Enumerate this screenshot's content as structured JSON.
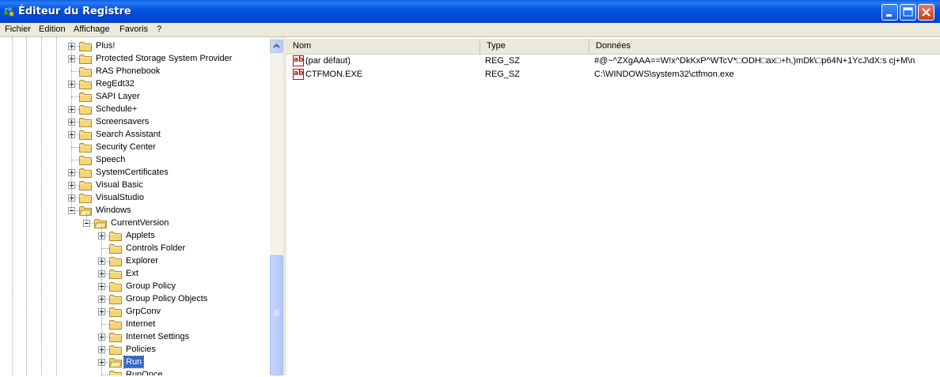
{
  "window": {
    "title": "Éditeur du Registre",
    "icon": "regedit-icon"
  },
  "menu": [
    "Fichier",
    "Edition",
    "Affichage",
    "Favoris",
    "?"
  ],
  "tree": {
    "items": [
      {
        "label": "Plus!",
        "level": 0,
        "expander": "plus"
      },
      {
        "label": "Protected Storage System Provider",
        "level": 0,
        "expander": "plus"
      },
      {
        "label": "RAS Phonebook",
        "level": 0,
        "expander": "none"
      },
      {
        "label": "RegEdt32",
        "level": 0,
        "expander": "plus"
      },
      {
        "label": "SAPI Layer",
        "level": 0,
        "expander": "none"
      },
      {
        "label": "Schedule+",
        "level": 0,
        "expander": "plus"
      },
      {
        "label": "Screensavers",
        "level": 0,
        "expander": "plus"
      },
      {
        "label": "Search Assistant",
        "level": 0,
        "expander": "plus"
      },
      {
        "label": "Security Center",
        "level": 0,
        "expander": "none"
      },
      {
        "label": "Speech",
        "level": 0,
        "expander": "none"
      },
      {
        "label": "SystemCertificates",
        "level": 0,
        "expander": "plus"
      },
      {
        "label": "Visual Basic",
        "level": 0,
        "expander": "plus"
      },
      {
        "label": "VisualStudio",
        "level": 0,
        "expander": "plus"
      },
      {
        "label": "Windows",
        "level": 0,
        "expander": "minus"
      },
      {
        "label": "CurrentVersion",
        "level": 1,
        "expander": "minus"
      },
      {
        "label": "Applets",
        "level": 2,
        "expander": "plus"
      },
      {
        "label": "Controls Folder",
        "level": 2,
        "expander": "none"
      },
      {
        "label": "Explorer",
        "level": 2,
        "expander": "plus"
      },
      {
        "label": "Ext",
        "level": 2,
        "expander": "plus"
      },
      {
        "label": "Group Policy",
        "level": 2,
        "expander": "plus"
      },
      {
        "label": "Group Policy Objects",
        "level": 2,
        "expander": "plus"
      },
      {
        "label": "GrpConv",
        "level": 2,
        "expander": "plus"
      },
      {
        "label": "Internet",
        "level": 2,
        "expander": "none"
      },
      {
        "label": "Internet Settings",
        "level": 2,
        "expander": "plus"
      },
      {
        "label": "Policies",
        "level": 2,
        "expander": "plus"
      },
      {
        "label": "Run",
        "level": 2,
        "expander": "plus",
        "selected": true
      },
      {
        "label": "RunOnce",
        "level": 2,
        "expander": "none"
      }
    ]
  },
  "list": {
    "columns": [
      "Nom",
      "Type",
      "Données"
    ],
    "rows": [
      {
        "name": "(par défaut)",
        "type": "REG_SZ",
        "data": "#@~^ZXgAAA==W!x^DkKxP^WTcV*□ODH□ax□+h,)mDk\\□p64N+1YcJ\\dX:s cj+M\\n"
      },
      {
        "name": "CTFMON.EXE",
        "type": "REG_SZ",
        "data": "C:\\WINDOWS\\system32\\ctfmon.exe"
      }
    ]
  },
  "colors": {
    "titlebar": "#0055e5",
    "selection": "#316ac5",
    "folder": "#f4d67a"
  }
}
